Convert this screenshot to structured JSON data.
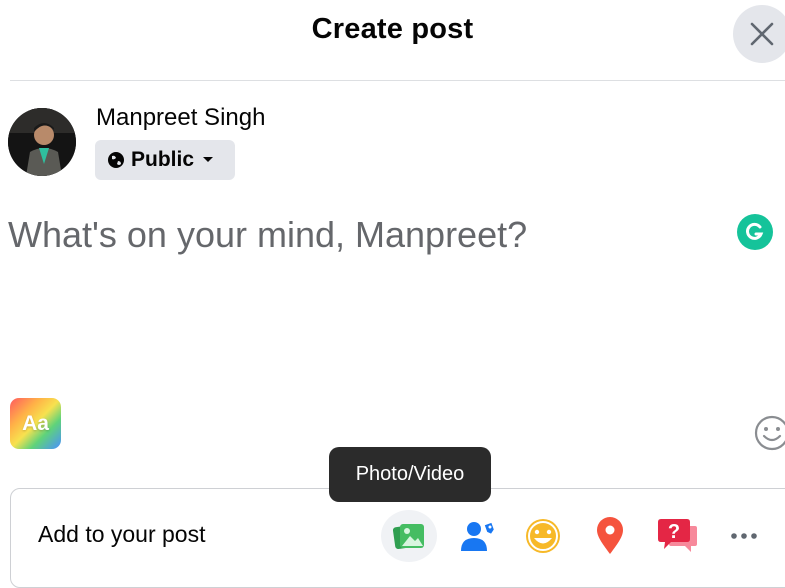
{
  "dialog": {
    "title": "Create post",
    "close_icon": "close-icon"
  },
  "user": {
    "name": "Manpreet Singh",
    "privacy": "Public",
    "privacy_icon": "globe-icon"
  },
  "composer": {
    "placeholder": "What's on your mind, Manpreet?"
  },
  "toolbar": {
    "background_label": "Aa",
    "tooltip": "Photo/Video",
    "add_label": "Add to your post",
    "tools": [
      {
        "icon": "photo-video-icon",
        "color": "#45bd62"
      },
      {
        "icon": "tag-people-icon",
        "color": "#1877f2"
      },
      {
        "icon": "feeling-icon",
        "color": "#f7b928"
      },
      {
        "icon": "check-in-icon",
        "color": "#f5533d"
      },
      {
        "icon": "ask-question-icon",
        "color": "#e42645"
      },
      {
        "icon": "more-icon",
        "color": "#606770"
      }
    ]
  }
}
